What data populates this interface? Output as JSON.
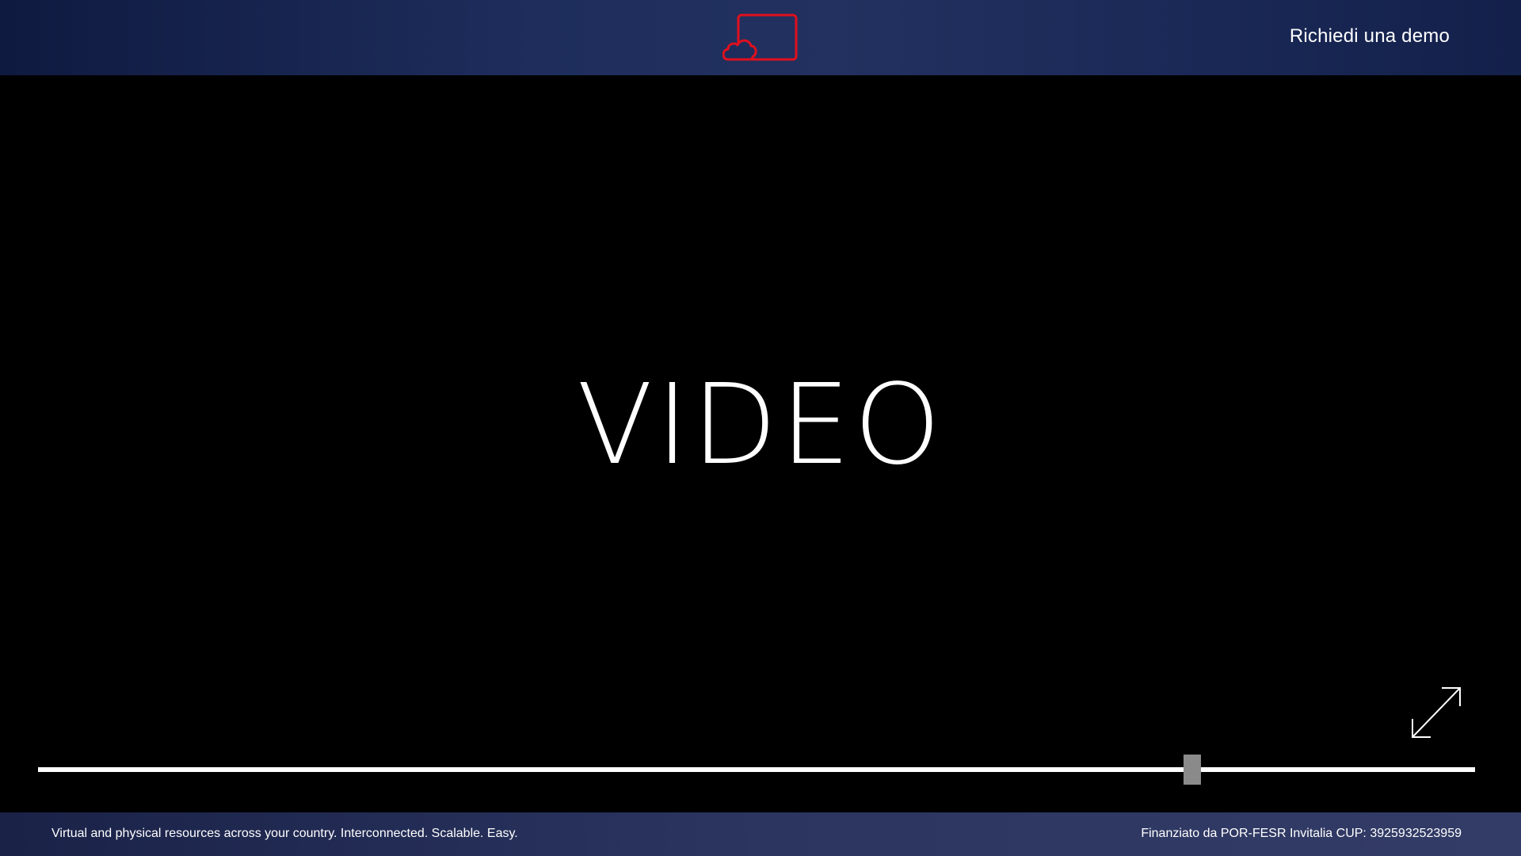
{
  "header": {
    "logo_icon": "cloud-screen-icon",
    "demo_label": "Richiedi una demo"
  },
  "video": {
    "title": "VIDEO",
    "expand_icon": "expand-arrows-icon",
    "progress": 0.803
  },
  "footer": {
    "tagline": "Virtual and physical resources across your country. Interconnected. Scalable. Easy.",
    "funding": "Finanziato da POR-FESR Invitalia CUP: 3925932523959"
  },
  "colors": {
    "header_bg": "#1e2d5c",
    "logo_red": "#e0101d",
    "thumb": "#8a8a8a"
  }
}
